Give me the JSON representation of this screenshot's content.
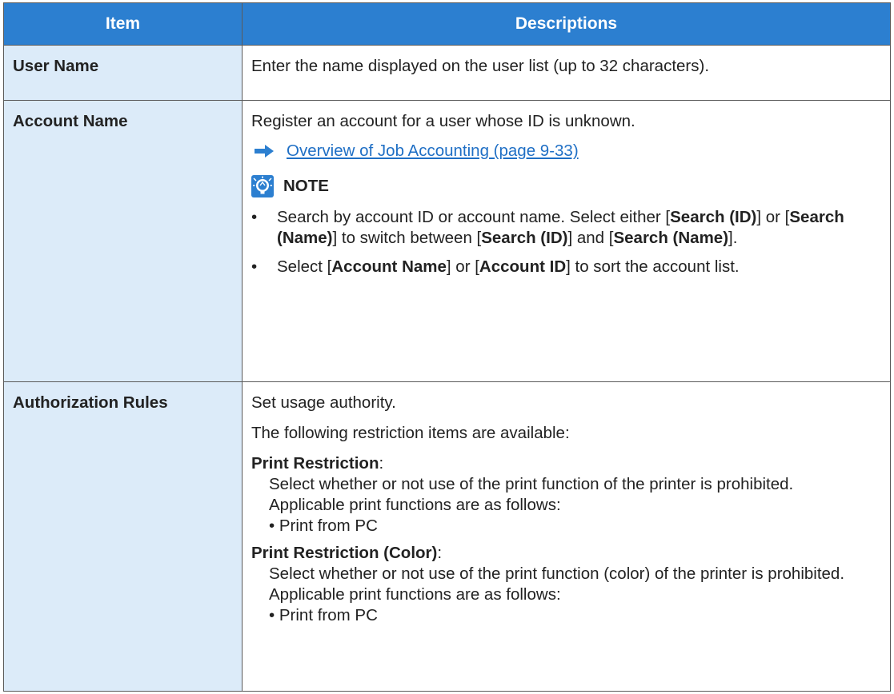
{
  "header": {
    "item": "Item",
    "descriptions": "Descriptions"
  },
  "rows": [
    {
      "item": "User Name",
      "desc": "Enter the name displayed on the user list (up to 32 characters)."
    },
    {
      "item": "Account Name",
      "desc": "Register an account for a user whose ID is unknown.",
      "link": "Overview of Job Accounting (page 9-33)",
      "note_title": "NOTE",
      "bullet1": {
        "a": "Search by account ID or account name. Select either [",
        "b": "Search (ID)",
        "c": "] or [",
        "d": "Search (Name)",
        "e": "] to switch between [",
        "f": "Search (ID)",
        "g": "] and [",
        "h": "Search (Name)",
        "i": "]."
      },
      "bullet2": {
        "a": "Select [",
        "b": "Account Name",
        "c": "] or [",
        "d": "Account ID",
        "e": "] to sort the account list."
      }
    },
    {
      "item": "Authorization Rules",
      "desc1": "Set usage authority.",
      "desc2": "The following restriction items are available:",
      "r1_title": "Print Restriction",
      "r1_colon": ":",
      "r1_l1": "Select whether or not use of the print function of the printer is prohibited.",
      "r1_l2": "Applicable print functions are as follows:",
      "r1_l3": "• Print from PC",
      "r2_title": "Print Restriction (Color)",
      "r2_colon": ":",
      "r2_l1": "Select whether or not use of the print function (color) of the printer is prohibited.",
      "r2_l2": "Applicable print functions are as follows:",
      "r2_l3": "• Print from PC"
    }
  ],
  "colors": {
    "header_bg": "#2c7fd0",
    "item_bg": "#dcebf9",
    "link": "#1f6fc5"
  },
  "icons": {
    "link_arrow": "arrow-right-icon",
    "note": "lightbulb-icon"
  }
}
